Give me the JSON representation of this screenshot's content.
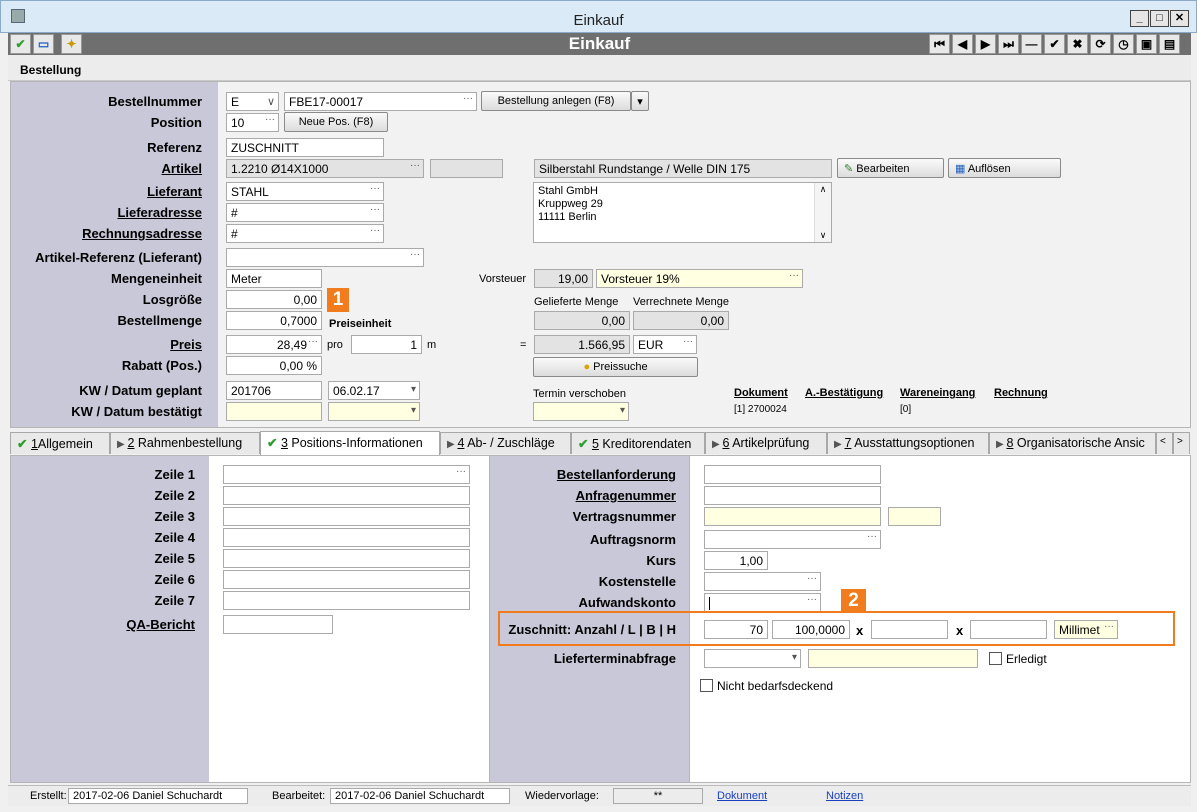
{
  "window": {
    "title": "Einkauf",
    "module": "Einkauf",
    "section": "Bestellung"
  },
  "toolbar": {
    "nav": [
      "⏮",
      "◀",
      "▶",
      "⏭",
      "—",
      "✔",
      "✖",
      "⟳",
      "◷",
      "▣",
      "▤"
    ]
  },
  "form": {
    "bestellnummer": {
      "label": "Bestellnummer",
      "prefix": "E",
      "value": "FBE17-00017",
      "button": "Bestellung anlegen (F8)"
    },
    "position": {
      "label": "Position",
      "value": "10",
      "button": "Neue Pos. (F8)"
    },
    "referenz": {
      "label": "Referenz",
      "value": "ZUSCHNITT"
    },
    "artikel": {
      "label": "Artikel",
      "value": "1.2210 Ø14X1000",
      "desc": "Silberstahl Rundstange / Welle DIN 175",
      "btn_edit": "Bearbeiten",
      "btn_resolve": "Auflösen"
    },
    "lieferant": {
      "label": "Lieferant",
      "value": "STAHL"
    },
    "lieferadresse": {
      "label": "Lieferadresse",
      "value": "#"
    },
    "rechnungsadresse": {
      "label": "Rechnungsadresse",
      "value": "#"
    },
    "address_lines": [
      "Stahl GmbH",
      "Kruppweg 29",
      "11111 Berlin"
    ],
    "artikel_ref": {
      "label": "Artikel-Referenz (Lieferant)",
      "value": ""
    },
    "mengeneinheit": {
      "label": "Mengeneinheit",
      "value": "Meter"
    },
    "vorsteuer": {
      "label": "Vorsteuer",
      "value": "19,00",
      "desc": "Vorsteuer 19%"
    },
    "losgroesse": {
      "label": "Losgröße",
      "value": "0,00"
    },
    "geliefert_label": "Gelieferte Menge",
    "verrechnet_label": "Verrechnete Menge",
    "geliefert": "0,00",
    "verrechnet": "0,00",
    "bestellmenge": {
      "label": "Bestellmenge",
      "value": "0,7000"
    },
    "preiseinheit_label": "Preiseinheit",
    "preis": {
      "label": "Preis",
      "value": "28,49",
      "pro": "pro",
      "pe": "1",
      "unit": "m",
      "eq": "=",
      "total": "1.566,95",
      "currency": "EUR"
    },
    "preissuche": "Preissuche",
    "rabatt": {
      "label": "Rabatt (Pos.)",
      "value": "0,00 %"
    },
    "kw_geplant": {
      "label": "KW / Datum geplant",
      "kw": "201706",
      "date": "06.02.17"
    },
    "kw_bestaetigt": {
      "label": "KW / Datum bestätigt",
      "kw": "",
      "date": ""
    },
    "termin_verschoben": "Termin verschoben",
    "docs": {
      "dokument": "Dokument",
      "ab": "A.-Bestätigung",
      "wareneingang": "Wareneingang",
      "rechnung": "Rechnung",
      "dokument_val": "[1] 2700024",
      "wareneingang_val": "[0]"
    }
  },
  "badges": {
    "b1": "1",
    "b2": "2"
  },
  "tabs": [
    {
      "num": "1",
      "label": "Allgemein"
    },
    {
      "num": "2",
      "label": "Rahmenbestellung"
    },
    {
      "num": "3",
      "label": "Positions-Informationen"
    },
    {
      "num": "4",
      "label": "Ab- / Zuschläge"
    },
    {
      "num": "5",
      "label": "Kreditorendaten"
    },
    {
      "num": "6",
      "label": "Artikelprüfung"
    },
    {
      "num": "7",
      "label": "Ausstattungsoptionen"
    },
    {
      "num": "8",
      "label": "Organisatorische Ansic"
    }
  ],
  "positions": {
    "zeilen": [
      "Zeile 1",
      "Zeile 2",
      "Zeile 3",
      "Zeile 4",
      "Zeile 5",
      "Zeile 6",
      "Zeile 7"
    ],
    "qa": "QA-Bericht",
    "bestellanforderung": "Bestellanforderung",
    "anfragenummer": "Anfragenummer",
    "vertragsnummer": "Vertragsnummer",
    "auftragsnorm": "Auftragsnorm",
    "kurs": {
      "label": "Kurs",
      "value": "1,00"
    },
    "kostenstelle": "Kostenstelle",
    "aufwandskonto": "Aufwandskonto",
    "zuschnitt": {
      "label": "Zuschnitt: Anzahl / L | B | H",
      "anzahl": "70",
      "l": "100,0000",
      "x": "x",
      "unit": "Millimet"
    },
    "lieferterminabfrage": "Lieferterminabfrage",
    "erledigt": "Erledigt",
    "nicht_bedarf": "Nicht bedarfsdeckend"
  },
  "status": {
    "erstellt_label": "Erstellt:",
    "erstellt": "2017-02-06  Daniel Schuchardt",
    "bearbeitet_label": "Bearbeitet:",
    "bearbeitet": "2017-02-06  Daniel Schuchardt",
    "wiedervorlage_label": "Wiedervorlage:",
    "wiedervorlage": "**",
    "dokument": "Dokument",
    "notizen": "Notizen"
  }
}
